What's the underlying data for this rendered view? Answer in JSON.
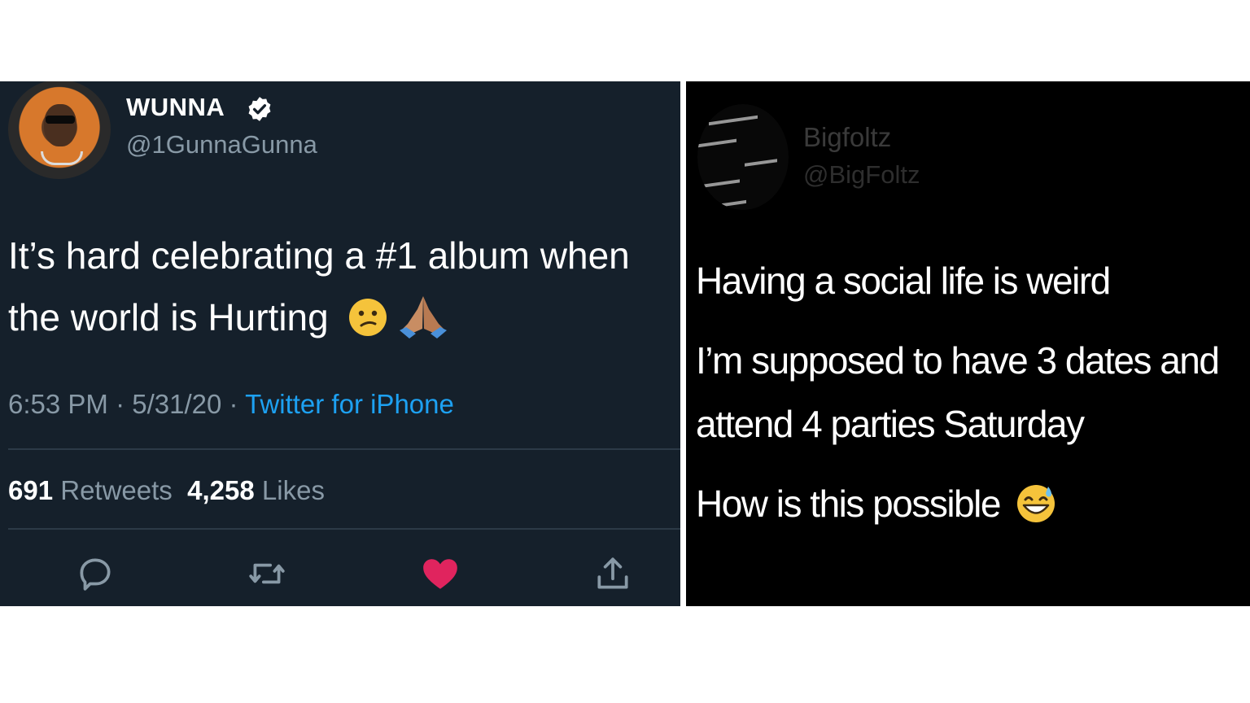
{
  "left_tweet": {
    "display_name": "WUNNA",
    "handle": "@1GunnaGunna",
    "text": "It’s hard celebrating a #1 album when the world is Hurting",
    "emojis": [
      "confused-face-emoji",
      "folded-hands-emoji"
    ],
    "time": "6:53 PM",
    "date": "5/31/20",
    "separator": " · ",
    "source": "Twitter for iPhone",
    "retweets_count": "691",
    "retweets_label": "Retweets",
    "likes_count": "4,258",
    "likes_label": "Likes",
    "actions": [
      "reply-icon",
      "retweet-icon",
      "like-icon",
      "share-icon"
    ],
    "colors": {
      "background": "#15202b",
      "link": "#1da1f2",
      "muted": "#8899a6",
      "like": "#e0245e"
    }
  },
  "right_tweet": {
    "display_name": "Bigfoltz",
    "handle": "@BigFoltz",
    "lines": [
      "Having a social life is weird",
      "I’m supposed to have 3 dates and",
      "attend 4 parties Saturday",
      "How is this possible"
    ],
    "emojis": [
      "grinning-face-with-sweat-emoji"
    ],
    "colors": {
      "background": "#000000",
      "text": "#ffffff"
    }
  }
}
